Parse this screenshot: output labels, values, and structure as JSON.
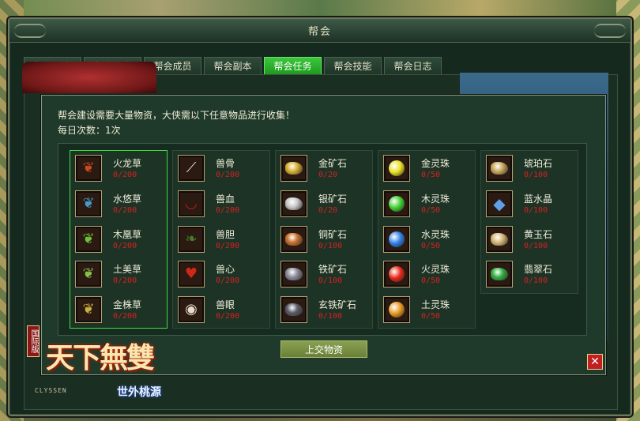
{
  "window": {
    "title": "帮会"
  },
  "tabs": [
    {
      "label": "帮会列表",
      "active": false
    },
    {
      "label": "帮会信息",
      "active": false
    },
    {
      "label": "帮会成员",
      "active": false
    },
    {
      "label": "帮会副本",
      "active": false
    },
    {
      "label": "帮会任务",
      "active": true
    },
    {
      "label": "帮会技能",
      "active": false
    },
    {
      "label": "帮会日志",
      "active": false
    }
  ],
  "task": {
    "intro": "帮会建设需要大量物资，大侠需以下任意物品进行收集！",
    "daily_label": "每日次数：1次"
  },
  "columns": [
    {
      "items": [
        {
          "name": "火龙草",
          "count": "0/200",
          "icon": "herb-icon",
          "color": "#c84a20"
        },
        {
          "name": "水悠草",
          "count": "0/200",
          "icon": "herb-icon",
          "color": "#4a9ac8"
        },
        {
          "name": "木凰草",
          "count": "0/200",
          "icon": "herb-icon",
          "color": "#6fbf3a"
        },
        {
          "name": "土美草",
          "count": "0/200",
          "icon": "herb-icon",
          "color": "#8abf4a"
        },
        {
          "name": "金株草",
          "count": "0/200",
          "icon": "herb-icon",
          "color": "#c8b040"
        }
      ]
    },
    {
      "items": [
        {
          "name": "兽骨",
          "count": "0/200",
          "icon": "bone-icon",
          "color": "#e8e0d0"
        },
        {
          "name": "兽血",
          "count": "0/200",
          "icon": "blood-bowl-icon",
          "color": "#c01818"
        },
        {
          "name": "兽胆",
          "count": "0/200",
          "icon": "gallbladder-icon",
          "color": "#4a7a2a"
        },
        {
          "name": "兽心",
          "count": "0/200",
          "icon": "heart-icon",
          "color": "#d02818"
        },
        {
          "name": "兽眼",
          "count": "0/200",
          "icon": "eye-icon",
          "color": "#e8dcc8"
        }
      ]
    },
    {
      "items": [
        {
          "name": "金矿石",
          "count": "0/20",
          "icon": "gold-ore-icon",
          "color": "#d8b030"
        },
        {
          "name": "银矿石",
          "count": "0/20",
          "icon": "silver-ore-icon",
          "color": "#c8c8c8"
        },
        {
          "name": "铜矿石",
          "count": "0/100",
          "icon": "copper-ore-icon",
          "color": "#c8702a"
        },
        {
          "name": "铁矿石",
          "count": "0/100",
          "icon": "iron-ore-icon",
          "color": "#8a8a9a"
        },
        {
          "name": "玄铁矿石",
          "count": "0/100",
          "icon": "dark-iron-ore-icon",
          "color": "#5a5a68"
        }
      ]
    },
    {
      "items": [
        {
          "name": "金灵珠",
          "count": "0/50",
          "icon": "gold-orb-icon",
          "color": "#e8e020"
        },
        {
          "name": "木灵珠",
          "count": "0/50",
          "icon": "wood-orb-icon",
          "color": "#40d030"
        },
        {
          "name": "水灵珠",
          "count": "0/50",
          "icon": "water-orb-icon",
          "color": "#3080e8"
        },
        {
          "name": "火灵珠",
          "count": "0/50",
          "icon": "fire-orb-icon",
          "color": "#e82818"
        },
        {
          "name": "土灵珠",
          "count": "0/50",
          "icon": "earth-orb-icon",
          "color": "#e89820"
        }
      ]
    },
    {
      "items": [
        {
          "name": "琥珀石",
          "count": "0/100",
          "icon": "amber-stone-icon",
          "color": "#c8a858"
        },
        {
          "name": "蓝水晶",
          "count": "0/100",
          "icon": "blue-crystal-icon",
          "color": "#60a0e8"
        },
        {
          "name": "黄玉石",
          "count": "0/100",
          "icon": "topaz-icon",
          "color": "#d8b878"
        },
        {
          "name": "翡翠石",
          "count": "0/100",
          "icon": "jade-icon",
          "color": "#30b040"
        }
      ]
    }
  ],
  "buttons": {
    "submit": "上交物资",
    "close": "✕"
  },
  "logo": {
    "main": "天下無雙",
    "sub": "世外桃源",
    "badge": "国际版",
    "latin": "CLYSSEN"
  }
}
